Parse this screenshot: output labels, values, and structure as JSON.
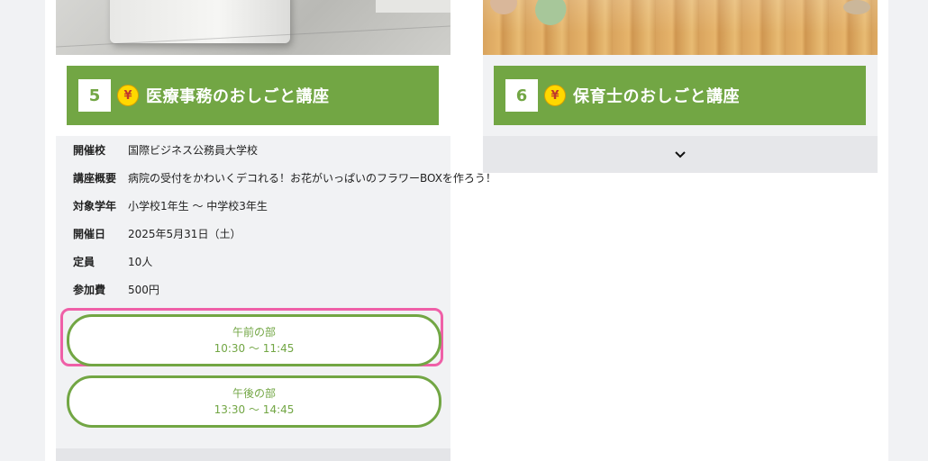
{
  "cards": [
    {
      "number": "5",
      "yen_symbol": "¥",
      "title": "医療事務のおしごと講座",
      "details": [
        {
          "label": "開催校",
          "value": "国際ビジネス公務員大学校"
        },
        {
          "label": "講座概要",
          "value": "病院の受付をかわいくデコれる！お花がいっぱいのフラワーBOXを作ろう！"
        },
        {
          "label": "対象学年",
          "value": "小学校1年生 〜 中学校3年生"
        },
        {
          "label": "開催日",
          "value": "2025年5月31日（土）"
        },
        {
          "label": "定員",
          "value": "10人"
        },
        {
          "label": "参加費",
          "value": "500円"
        }
      ],
      "sessions": [
        {
          "name": "午前の部",
          "time": "10:30 〜 11:45"
        },
        {
          "name": "午後の部",
          "time": "13:30 〜 14:45"
        }
      ]
    },
    {
      "number": "6",
      "yen_symbol": "¥",
      "title": "保育士のおしごと講座"
    }
  ],
  "icons": {
    "yen": "yen-coin-icon",
    "expand": "chevron-down-icon"
  },
  "colors": {
    "accent_green": "#72a644",
    "focus_pink": "#ef5fa7",
    "yen_yellow": "#ffd800"
  }
}
